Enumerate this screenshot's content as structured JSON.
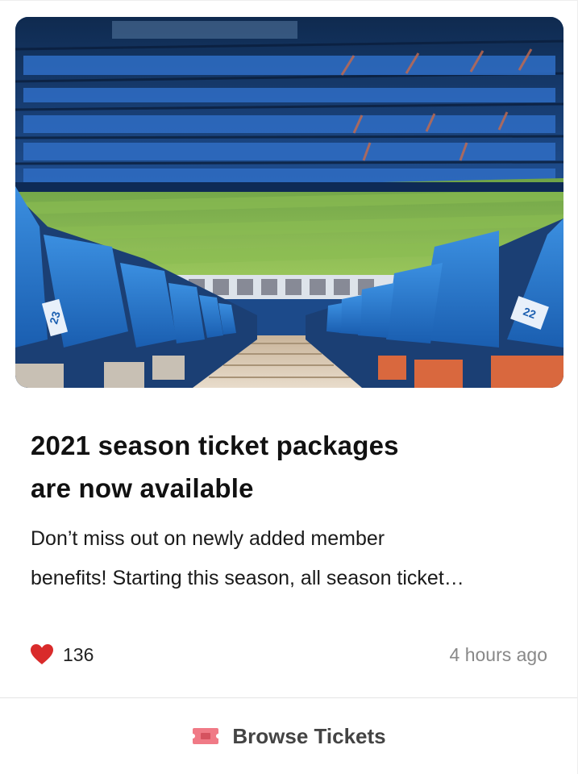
{
  "card": {
    "image_alt": "Empty stadium with blue seats and green pitch",
    "title_line1": "2021 season ticket packages",
    "title_line2": "are now available",
    "desc_line1": "Don’t miss out on newly added member",
    "desc_line2": "benefits! Starting this season, all season ticket…",
    "likes": "136",
    "timestamp": "4 hours ago",
    "like_icon": "heart-icon",
    "like_color": "#d92b2b"
  },
  "footer": {
    "button_label": "Browse Tickets",
    "button_icon": "ticket-icon",
    "icon_color": "#f07a86"
  },
  "hero_seat_labels": {
    "left": "23",
    "right": "22"
  }
}
